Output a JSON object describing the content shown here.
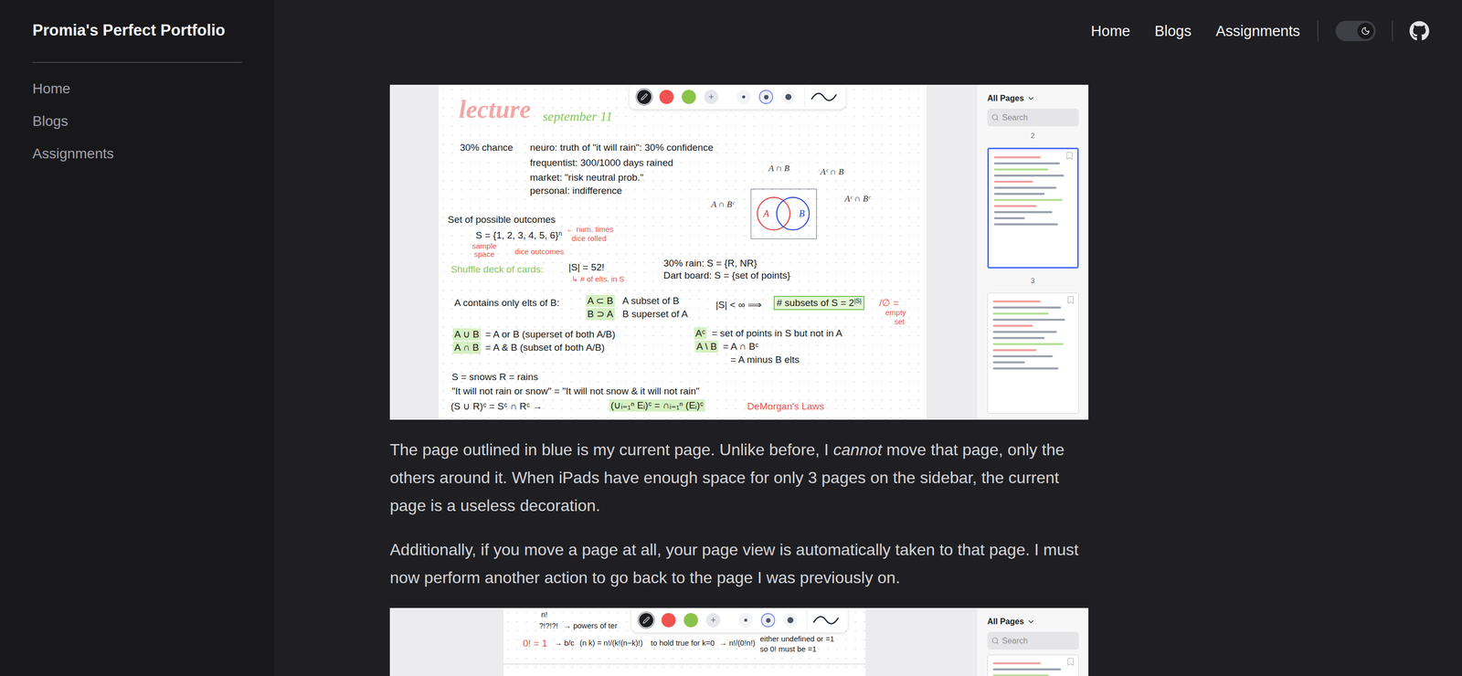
{
  "site_title": "Promia's Perfect Portfolio",
  "sidebar": {
    "items": [
      {
        "label": "Home",
        "selected": false
      },
      {
        "label": "Blogs",
        "selected": false
      },
      {
        "label": "Assignments",
        "selected": false
      }
    ]
  },
  "nav": {
    "items": [
      {
        "label": "Home",
        "selected": false
      },
      {
        "label": "Blogs",
        "selected": false
      },
      {
        "label": "Assignments",
        "selected": false
      }
    ],
    "theme_toggle": {
      "dark": true
    }
  },
  "content": [
    {
      "kind": "figure",
      "toolbar": {
        "tools": [
          {
            "kind": "pen",
            "color": "#1c1c1e",
            "text": "",
            "selected": true
          },
          {
            "kind": "color",
            "color": "#ef5350",
            "text": "",
            "selected": false
          },
          {
            "kind": "color",
            "color": "#8bc34a",
            "text": "",
            "selected": false
          },
          {
            "kind": "add",
            "color": "#e5e7eb",
            "text": "+",
            "selected": false
          }
        ],
        "sizes": [
          {
            "selected": false
          },
          {
            "selected": true
          },
          {
            "selected": false
          }
        ]
      },
      "note": {
        "items": [
          {
            "text": "lecture",
            "color": "#f4a6a6",
            "kind": "title",
            "highlight": false,
            "boxed": false,
            "sup": ""
          },
          {
            "text": "september 11",
            "color": "#86c95b",
            "kind": "subtitle",
            "highlight": false,
            "boxed": false,
            "sup": ""
          },
          {
            "text": "30% chance",
            "color": "#1a1a1a",
            "kind": "text",
            "highlight": false,
            "boxed": false,
            "sup": ""
          },
          {
            "text": "neuro: truth of \"it will rain\": 30% confidence",
            "color": "#1a1a1a",
            "kind": "text",
            "highlight": false,
            "boxed": false,
            "sup": ""
          },
          {
            "text": "frequentist: 300/1000 days rained",
            "color": "#1a1a1a",
            "kind": "text",
            "highlight": false,
            "boxed": false,
            "sup": ""
          },
          {
            "text": "market: \"risk neutral prob.\"",
            "color": "#1a1a1a",
            "kind": "text",
            "highlight": false,
            "boxed": false,
            "sup": ""
          },
          {
            "text": "personal: indifference",
            "color": "#1a1a1a",
            "kind": "text",
            "highlight": false,
            "boxed": false,
            "sup": ""
          },
          {
            "text": "Set of possible outcomes",
            "color": "#1a1a1a",
            "kind": "text",
            "highlight": false,
            "boxed": false,
            "sup": ""
          },
          {
            "text": "S = {1, 2, 3, 4, 5, 6}",
            "color": "#1a1a1a",
            "kind": "text",
            "highlight": false,
            "boxed": false,
            "sup": "n"
          },
          {
            "text": "← num. times",
            "color": "#e4574f",
            "kind": "small",
            "highlight": false,
            "boxed": false,
            "sup": ""
          },
          {
            "text": "dice rolled",
            "color": "#e4574f",
            "kind": "small",
            "highlight": false,
            "boxed": false,
            "sup": ""
          },
          {
            "text": "sample",
            "color": "#e4574f",
            "kind": "small",
            "highlight": false,
            "boxed": false,
            "sup": ""
          },
          {
            "text": "space",
            "color": "#e4574f",
            "kind": "small",
            "highlight": false,
            "boxed": false,
            "sup": ""
          },
          {
            "text": "dice outcomes",
            "color": "#e4574f",
            "kind": "small",
            "highlight": false,
            "boxed": false,
            "sup": ""
          },
          {
            "text": "Shuffle deck of cards:",
            "color": "#86c95b",
            "kind": "text",
            "highlight": false,
            "boxed": false,
            "sup": ""
          },
          {
            "text": "|S| = 52!",
            "color": "#1a1a1a",
            "kind": "text",
            "highlight": false,
            "boxed": false,
            "sup": ""
          },
          {
            "text": "↳ # of elts. in S",
            "color": "#e4574f",
            "kind": "small",
            "highlight": false,
            "boxed": false,
            "sup": ""
          },
          {
            "text": "30% rain:   S = {R, NR}",
            "color": "#1a1a1a",
            "kind": "text",
            "highlight": false,
            "boxed": false,
            "sup": ""
          },
          {
            "text": "Dart board:  S = {set of points}",
            "color": "#1a1a1a",
            "kind": "text",
            "highlight": false,
            "boxed": false,
            "sup": ""
          },
          {
            "text": "A contains only elts of B:",
            "color": "#1a1a1a",
            "kind": "text",
            "highlight": false,
            "boxed": false,
            "sup": ""
          },
          {
            "text": "A ⊂ B",
            "color": "#1a1a1a",
            "kind": "text",
            "highlight": true,
            "boxed": false,
            "sup": ""
          },
          {
            "text": "A subset of B",
            "color": "#1a1a1a",
            "kind": "text",
            "highlight": false,
            "boxed": false,
            "sup": ""
          },
          {
            "text": "B ⊃ A",
            "color": "#1a1a1a",
            "kind": "text",
            "highlight": true,
            "boxed": false,
            "sup": ""
          },
          {
            "text": "B superset of A",
            "color": "#1a1a1a",
            "kind": "text",
            "highlight": false,
            "boxed": false,
            "sup": ""
          },
          {
            "text": "|S| < ∞ ⟹",
            "color": "#1a1a1a",
            "kind": "text",
            "highlight": false,
            "boxed": false,
            "sup": ""
          },
          {
            "text": "# subsets of S = 2",
            "color": "#1a1a1a",
            "kind": "text",
            "highlight": false,
            "boxed": true,
            "sup": "|S|"
          },
          {
            "text": "/∅ =",
            "color": "#e4574f",
            "kind": "text",
            "highlight": false,
            "boxed": false,
            "sup": ""
          },
          {
            "text": "empty",
            "color": "#e4574f",
            "kind": "small",
            "highlight": false,
            "boxed": false,
            "sup": ""
          },
          {
            "text": "set",
            "color": "#e4574f",
            "kind": "small",
            "highlight": false,
            "boxed": false,
            "sup": ""
          },
          {
            "text": "A ∪ B",
            "color": "#1a1a1a",
            "kind": "text",
            "highlight": true,
            "boxed": false,
            "sup": ""
          },
          {
            "text": "= A or B  (superset of both A/B)",
            "color": "#1a1a1a",
            "kind": "text",
            "highlight": false,
            "boxed": false,
            "sup": ""
          },
          {
            "text": "A ∩ B",
            "color": "#1a1a1a",
            "kind": "text",
            "highlight": true,
            "boxed": false,
            "sup": ""
          },
          {
            "text": "= A & B  (subset of both A/B)",
            "color": "#1a1a1a",
            "kind": "text",
            "highlight": false,
            "boxed": false,
            "sup": ""
          },
          {
            "text": "Aᶜ",
            "color": "#1a1a1a",
            "kind": "text",
            "highlight": true,
            "boxed": false,
            "sup": ""
          },
          {
            "text": "= set of points in S but not in A",
            "color": "#1a1a1a",
            "kind": "text",
            "highlight": false,
            "boxed": false,
            "sup": ""
          },
          {
            "text": "A \\ B",
            "color": "#1a1a1a",
            "kind": "text",
            "highlight": true,
            "boxed": false,
            "sup": ""
          },
          {
            "text": "= A ∩ Bᶜ",
            "color": "#1a1a1a",
            "kind": "text",
            "highlight": false,
            "boxed": false,
            "sup": ""
          },
          {
            "text": "= A minus B elts",
            "color": "#1a1a1a",
            "kind": "text",
            "highlight": false,
            "boxed": false,
            "sup": ""
          },
          {
            "text": "S = snows   R = rains",
            "color": "#1a1a1a",
            "kind": "text",
            "highlight": false,
            "boxed": false,
            "sup": ""
          },
          {
            "text": "\"It will not rain or snow\" = \"It will not snow & it will not rain\"",
            "color": "#1a1a1a",
            "kind": "text",
            "highlight": false,
            "boxed": false,
            "sup": ""
          },
          {
            "text": "(S ∪ R)ᶜ = Sᶜ ∩ Rᶜ  →",
            "color": "#1a1a1a",
            "kind": "text",
            "highlight": false,
            "boxed": false,
            "sup": ""
          },
          {
            "text": "(∪ᵢ₌₁ⁿ Eᵢ)ᶜ = ∩ᵢ₌₁ⁿ (Eᵢ)ᶜ",
            "color": "#1a1a1a",
            "kind": "text",
            "highlight": true,
            "boxed": false,
            "sup": ""
          },
          {
            "text": "DeMorgan's Laws",
            "color": "#e4574f",
            "kind": "text",
            "highlight": false,
            "boxed": false,
            "sup": ""
          }
        ],
        "venn": {
          "circles": [
            {
              "label": "A",
              "color": "#e53935"
            },
            {
              "label": "B",
              "color": "#1e3fd8"
            }
          ],
          "labels": [
            "A ∩ B",
            "Aᶜ ∩ B",
            "A ∩ Bᶜ",
            "Aᶜ ∩ Bᶜ"
          ]
        }
      },
      "page_panel": {
        "filter": "All Pages",
        "search_placeholder": "Search",
        "items": [
          {
            "kind": "label",
            "text": "2",
            "current": false
          },
          {
            "kind": "thumb",
            "text": "",
            "current": true
          },
          {
            "kind": "label",
            "text": "3",
            "current": false
          },
          {
            "kind": "thumb",
            "text": "",
            "current": false
          }
        ]
      }
    },
    {
      "kind": "paragraph",
      "segments": [
        {
          "text": "The page outlined in blue is my current page. Unlike before, I ",
          "italic": false
        },
        {
          "text": "cannot",
          "italic": true
        },
        {
          "text": " move that page, only the others around it. When iPads have enough space for only 3 pages on the sidebar, the current page is a useless decoration.",
          "italic": false
        }
      ]
    },
    {
      "kind": "paragraph",
      "segments": [
        {
          "text": "Additionally, if you move a page at all, your page view is automatically taken to that page. I must now perform another action to go back to the page I was previously on.",
          "italic": false
        }
      ]
    },
    {
      "kind": "figure",
      "toolbar": {
        "tools": [
          {
            "kind": "pen",
            "color": "#1c1c1e",
            "text": "",
            "selected": true
          },
          {
            "kind": "color",
            "color": "#ef5350",
            "text": "",
            "selected": false
          },
          {
            "kind": "color",
            "color": "#8bc34a",
            "text": "",
            "selected": false
          },
          {
            "kind": "add",
            "color": "#e5e7eb",
            "text": "+",
            "selected": false
          }
        ],
        "sizes": [
          {
            "selected": false
          },
          {
            "selected": true
          },
          {
            "selected": false
          }
        ]
      },
      "note": {
        "items": [
          {
            "text": "n!",
            "color": "#1a1a1a",
            "kind": "small",
            "highlight": false,
            "boxed": false,
            "sup": ""
          },
          {
            "text": "?!?!?!",
            "color": "#1a1a1a",
            "kind": "small",
            "highlight": false,
            "boxed": false,
            "sup": ""
          },
          {
            "text": "→ powers of ter",
            "color": "#1a1a1a",
            "kind": "small",
            "highlight": false,
            "boxed": false,
            "sup": ""
          },
          {
            "text": "0! = 1",
            "color": "#e4574f",
            "kind": "text",
            "highlight": false,
            "boxed": false,
            "sup": ""
          },
          {
            "text": "→ b/c",
            "color": "#1a1a1a",
            "kind": "small",
            "highlight": false,
            "boxed": false,
            "sup": ""
          },
          {
            "text": "(n k) = n!/(k!(n−k)!)",
            "color": "#1a1a1a",
            "kind": "small",
            "highlight": false,
            "boxed": false,
            "sup": ""
          },
          {
            "text": "to hold true for k=0",
            "color": "#1a1a1a",
            "kind": "small",
            "highlight": false,
            "boxed": false,
            "sup": ""
          },
          {
            "text": "→ n!/(0!n!)",
            "color": "#1a1a1a",
            "kind": "small",
            "highlight": false,
            "boxed": false,
            "sup": ""
          },
          {
            "text": "either undefined or =1",
            "color": "#1a1a1a",
            "kind": "small",
            "highlight": false,
            "boxed": false,
            "sup": ""
          },
          {
            "text": "so 0! must be =1",
            "color": "#1a1a1a",
            "kind": "small",
            "highlight": false,
            "boxed": false,
            "sup": ""
          }
        ]
      },
      "page_panel": {
        "filter": "All Pages",
        "search_placeholder": "Search",
        "items": [
          {
            "kind": "thumb",
            "text": "",
            "current": false
          }
        ]
      }
    }
  ]
}
